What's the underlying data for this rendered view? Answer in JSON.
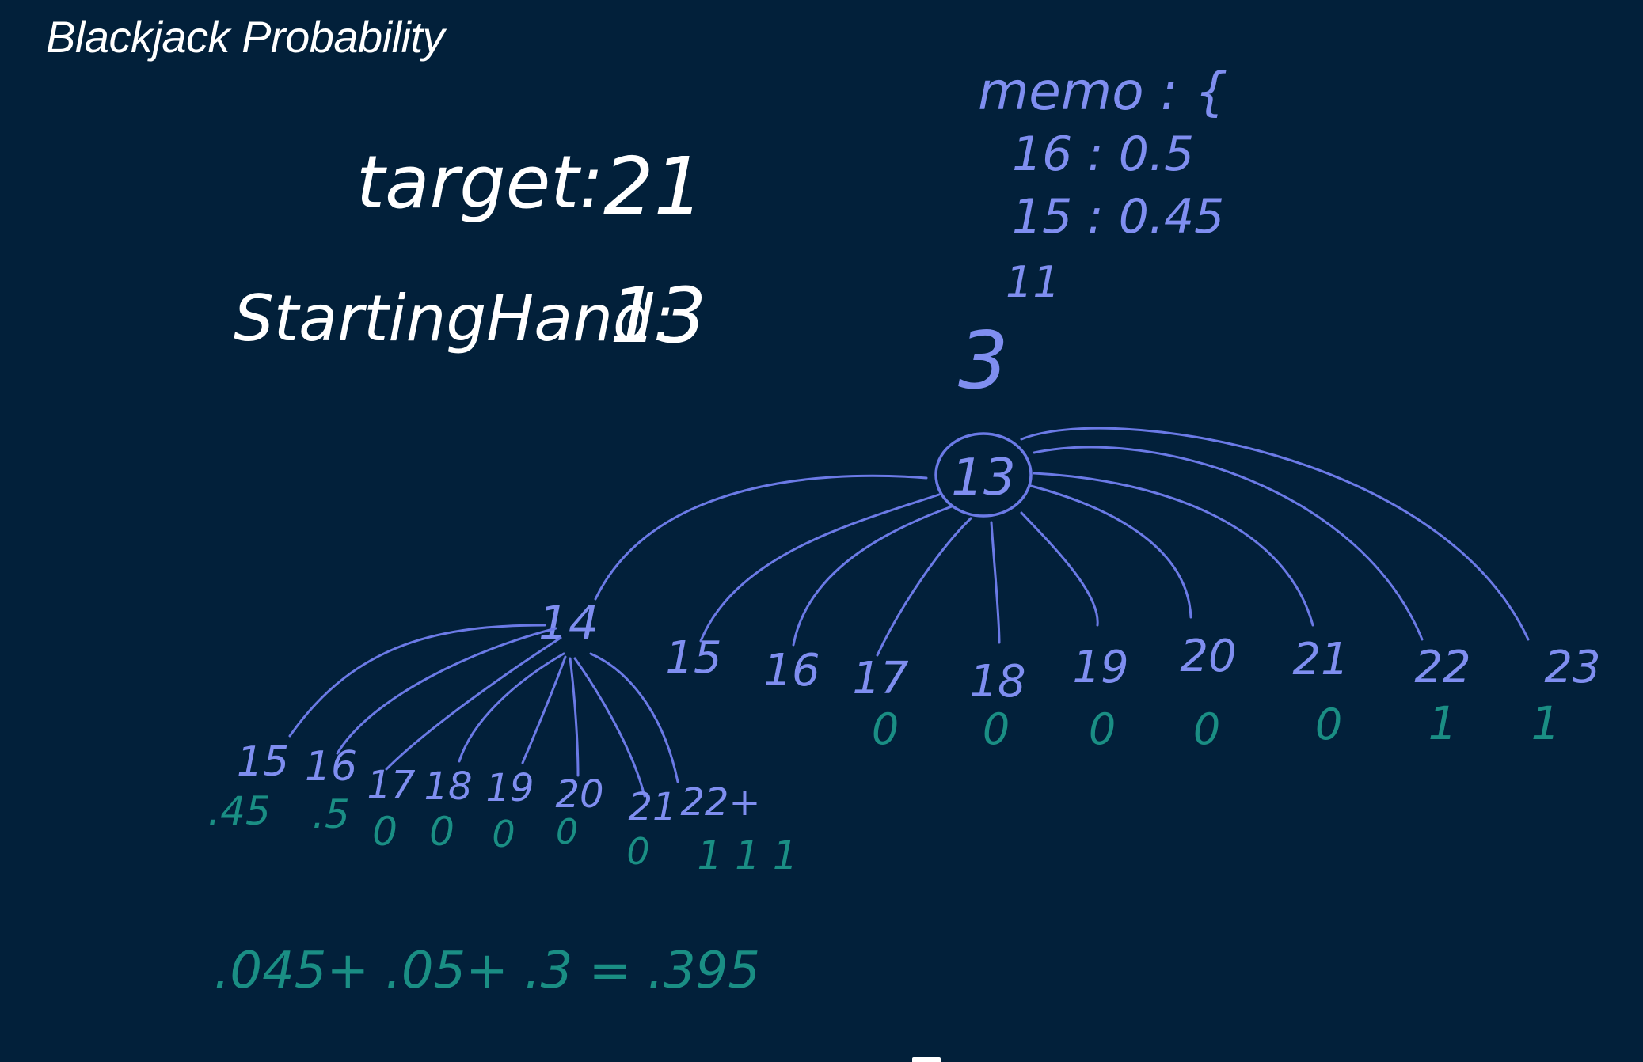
{
  "title": "Blackjack Probability",
  "target": {
    "label": "target:",
    "value": "21"
  },
  "starting_hand": {
    "label": "StartingHand:",
    "value": "13"
  },
  "memo": {
    "header": "memo : {",
    "entries": [
      "16 : 0.5",
      "15 : 0.45"
    ],
    "ditto": "11",
    "closing": "3"
  },
  "root_node": "13",
  "root_children": [
    {
      "label": "14",
      "value": ""
    },
    {
      "label": "15",
      "value": ""
    },
    {
      "label": "16",
      "value": ""
    },
    {
      "label": "17",
      "value": "0"
    },
    {
      "label": "18",
      "value": "0"
    },
    {
      "label": "19",
      "value": "0"
    },
    {
      "label": "20",
      "value": "0"
    },
    {
      "label": "21",
      "value": "0"
    },
    {
      "label": "22",
      "value": "1"
    },
    {
      "label": "23",
      "value": "1"
    }
  ],
  "sub_children": [
    {
      "label": "15",
      "value": ".45"
    },
    {
      "label": "16",
      "value": ".5"
    },
    {
      "label": "17",
      "value": "0"
    },
    {
      "label": "18",
      "value": "0"
    },
    {
      "label": "19",
      "value": "0"
    },
    {
      "label": "20",
      "value": "0"
    },
    {
      "label": "21",
      "value": "0"
    },
    {
      "label": "22+",
      "value": "1 1 1"
    }
  ],
  "sum_equation": ".045+ .05+ .3 = .395",
  "colors": {
    "background": "#02203a",
    "chalk_white": "#ffffff",
    "tree_blue": "#7f8ef0",
    "value_green": "#1a8e84"
  }
}
